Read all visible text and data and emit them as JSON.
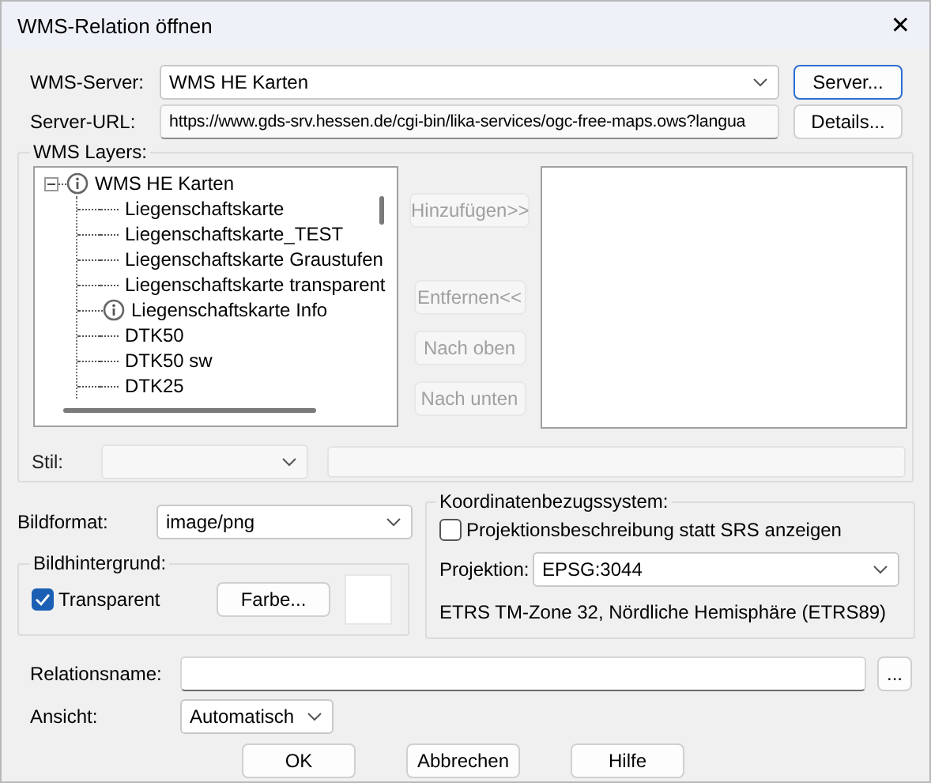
{
  "window": {
    "title": "WMS-Relation öffnen",
    "close": "✕"
  },
  "server": {
    "label": "WMS-Server:",
    "value": "WMS HE Karten",
    "button": {
      "label": "Server...",
      "focused": true
    }
  },
  "server_url": {
    "label": "Server-URL:",
    "value": "https://www.gds-srv.hessen.de/cgi-bin/lika-services/ogc-free-maps.ows?langua",
    "button": {
      "label": "Details...",
      "focused": false
    }
  },
  "layers": {
    "title": "WMS Layers:",
    "tree": {
      "label": "WMS HE Karten",
      "kind": "info",
      "expanded": true,
      "children": [
        {
          "label": "Liegenschaftskarte",
          "kind": "layer"
        },
        {
          "label": "Liegenschaftskarte_TEST",
          "kind": "layer"
        },
        {
          "label": "Liegenschaftskarte Graustufen",
          "kind": "layer"
        },
        {
          "label": "Liegenschaftskarte transparent",
          "kind": "layer"
        },
        {
          "label": "Liegenschaftskarte Info",
          "kind": "info"
        },
        {
          "label": "DTK50",
          "kind": "layer"
        },
        {
          "label": "DTK50 sw",
          "kind": "layer"
        },
        {
          "label": "DTK25",
          "kind": "layer"
        }
      ]
    },
    "buttons": [
      {
        "label": "Hinzufügen>>",
        "disabled": true
      },
      {
        "label": "Entfernen<<",
        "disabled": true
      },
      {
        "label": "Nach oben",
        "disabled": true
      },
      {
        "label": "Nach unten",
        "disabled": true
      }
    ],
    "style": {
      "label": "Stil:",
      "disabled": true
    }
  },
  "format": {
    "label": "Bildformat:",
    "value": "image/png"
  },
  "background": {
    "title": "Bildhintergrund:",
    "transparent": {
      "label": "Transparent",
      "checked": true
    },
    "color_button": "Farbe...",
    "color": "#ffffff"
  },
  "crs": {
    "title": "Koordinatenbezugssystem:",
    "show_description": {
      "label": "Projektionsbeschreibung statt SRS anzeigen",
      "checked": false
    },
    "projection_label": "Projektion:",
    "projection": "EPSG:3044",
    "description": "ETRS TM-Zone 32, Nördliche Hemisphäre (ETRS89)"
  },
  "relation_name": {
    "label": "Relationsname:",
    "browse": "..."
  },
  "view": {
    "label": "Ansicht:",
    "value": "Automatisch"
  },
  "buttons": [
    "OK",
    "Abbrechen",
    "Hilfe"
  ]
}
